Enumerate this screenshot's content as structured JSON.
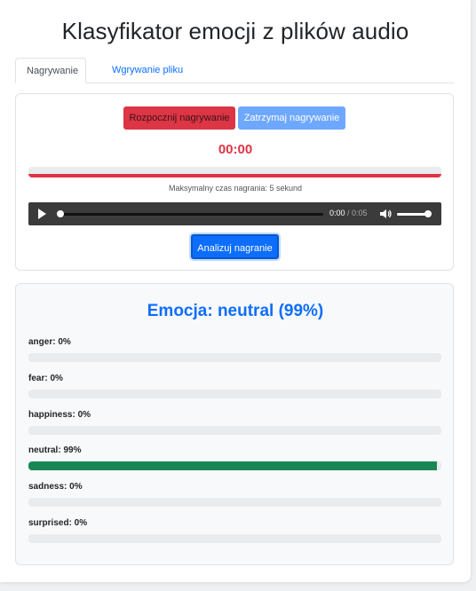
{
  "page": {
    "title": "Klasyfikator emocji z plików audio"
  },
  "tabs": [
    {
      "label": "Nagrywanie",
      "active": true
    },
    {
      "label": "Wgrywanie pliku",
      "active": false
    }
  ],
  "recording": {
    "start_label": "Rozpocznij nagrywanie",
    "stop_label": "Zatrzymaj nagrywanie",
    "timer": "00:00",
    "max_time_text": "Maksymalny czas nagrania: 5 sekund",
    "player": {
      "current": "0:00",
      "duration": " / 0:05"
    },
    "analyze_label": "Analizuj nagranie"
  },
  "result": {
    "title": "Emocja: neutral (99%)",
    "emotions": [
      {
        "label": "anger: 0%",
        "value": 0
      },
      {
        "label": "fear: 0%",
        "value": 0
      },
      {
        "label": "happiness: 0%",
        "value": 0
      },
      {
        "label": "neutral: 99%",
        "value": 99
      },
      {
        "label": "sadness: 0%",
        "value": 0
      },
      {
        "label": "surprised: 0%",
        "value": 0
      }
    ]
  },
  "colors": {
    "danger": "#dc3545",
    "primary": "#0d6efd",
    "primary_light": "#6ea8fe",
    "success": "#198754"
  }
}
